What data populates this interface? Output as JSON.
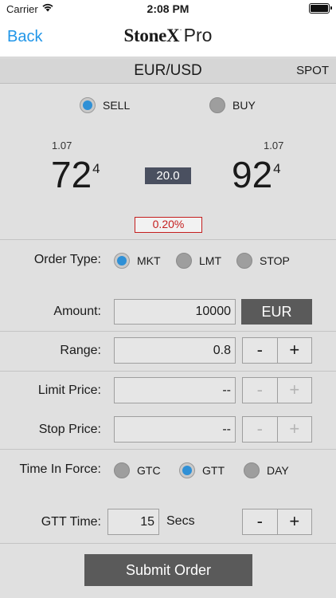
{
  "status_bar": {
    "carrier": "Carrier",
    "time": "2:08 PM"
  },
  "nav": {
    "back_label": "Back",
    "logo_brand": "StoneX",
    "logo_mark": "·",
    "logo_suffix": "Pro"
  },
  "pair_header": {
    "pair": "EUR/USD",
    "market": "SPOT"
  },
  "side": {
    "sell_label": "SELL",
    "buy_label": "BUY",
    "selected": "SELL"
  },
  "quote": {
    "sell_prefix": "1.07",
    "sell_big": "72",
    "sell_pip": "4",
    "buy_prefix": "1.07",
    "buy_big": "92",
    "buy_pip": "4",
    "spread": "20.0",
    "pct": "0.20%"
  },
  "order_type": {
    "label": "Order Type:",
    "options": [
      "MKT",
      "LMT",
      "STOP"
    ],
    "selected": "MKT"
  },
  "amount": {
    "label": "Amount:",
    "value": "10000",
    "currency": "EUR"
  },
  "range": {
    "label": "Range:",
    "value": "0.8",
    "minus": "-",
    "plus": "+"
  },
  "limit_price": {
    "label": "Limit Price:",
    "value": "--",
    "minus": "-",
    "plus": "+"
  },
  "stop_price": {
    "label": "Stop Price:",
    "value": "--",
    "minus": "-",
    "plus": "+"
  },
  "time_in_force": {
    "label": "Time In Force:",
    "options": [
      "GTC",
      "GTT",
      "DAY"
    ],
    "selected": "GTT"
  },
  "gtt_time": {
    "label": "GTT Time:",
    "value": "15",
    "unit": "Secs",
    "minus": "-",
    "plus": "+"
  },
  "submit_label": "Submit Order",
  "colors": {
    "accent": "#2f90d6",
    "link": "#2196e8",
    "alert": "#c41e1e",
    "button": "#5a5a5a",
    "spread_bg": "#4a5060"
  }
}
